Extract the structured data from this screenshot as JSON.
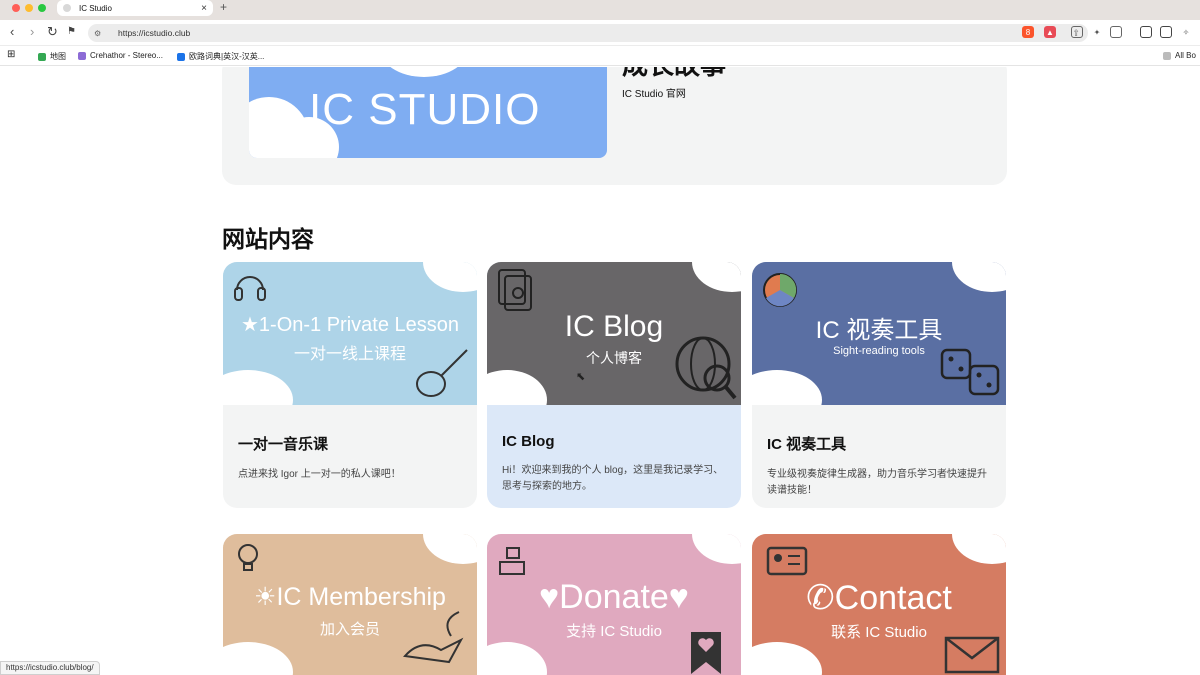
{
  "browser": {
    "tab_title": "IC Studio",
    "tab_close": "×",
    "new_tab": "+",
    "url": "https://icstudio.club",
    "back": "‹",
    "forward": "›",
    "reload": "↻",
    "bookmark": "⚑",
    "bookmarks": [
      {
        "label": "地图",
        "color": "#34a853"
      },
      {
        "label": "Crehathor - Stereo...",
        "color": "#8c6bd6"
      },
      {
        "label": "欧路词典|英汉-汉英...",
        "color": "#1b73e8"
      }
    ],
    "all_bookmarks": "All Bo",
    "brave_badge": "8",
    "status_url": "https://icstudio.club/blog/"
  },
  "hero": {
    "image_text": "IC STUDIO",
    "title": "成长故事",
    "subtitle": "IC Studio 官网"
  },
  "section_title": "网站内容",
  "cards": [
    {
      "img_title": "★1-On-1 Private Lesson",
      "img_sub": "一对一线上课程",
      "title": "一对一音乐课",
      "desc": "点进来找 Igor 上一对一的私人课吧！",
      "bg": "#aed4e8"
    },
    {
      "img_title": "IC Blog",
      "img_sub": "个人博客",
      "title": "IC Blog",
      "desc": "Hi！欢迎来到我的个人 blog，这里是我记录学习、思考与探索的地方。",
      "bg": "#686668"
    },
    {
      "img_title": "IC 视奏工具",
      "img_sub": "Sight-reading tools",
      "title": "IC 视奏工具",
      "desc": "专业级视奏旋律生成器，助力音乐学习者快速提升读谱技能！",
      "bg": "#5a6fa3"
    },
    {
      "img_title": "☀IC Membership",
      "img_sub": "加入会员",
      "bg": "#dfbd9c"
    },
    {
      "img_title": "♥Donate♥",
      "img_sub": "支持 IC Studio",
      "bg": "#e0a9bf"
    },
    {
      "img_title": "✆Contact",
      "img_sub": "联系 IC Studio",
      "bg": "#d57c62"
    }
  ]
}
